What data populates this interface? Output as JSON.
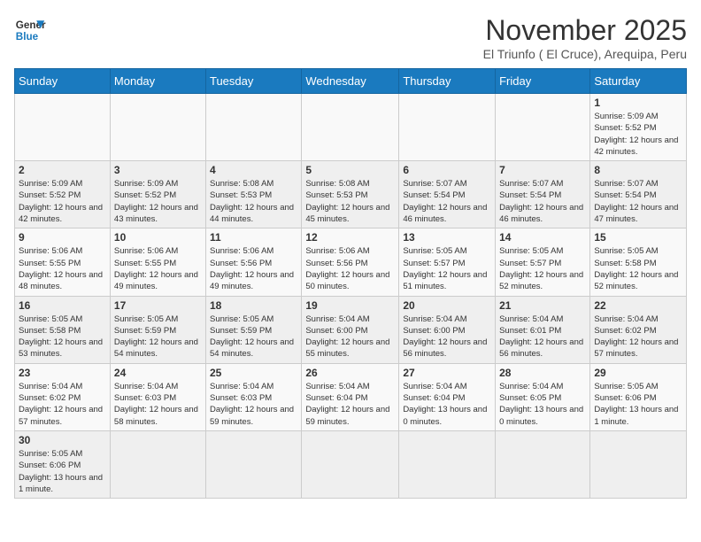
{
  "header": {
    "logo_general": "General",
    "logo_blue": "Blue",
    "title": "November 2025",
    "subtitle": "El Triunfo ( El Cruce), Arequipa, Peru"
  },
  "weekdays": [
    "Sunday",
    "Monday",
    "Tuesday",
    "Wednesday",
    "Thursday",
    "Friday",
    "Saturday"
  ],
  "weeks": [
    [
      {
        "day": "",
        "info": ""
      },
      {
        "day": "",
        "info": ""
      },
      {
        "day": "",
        "info": ""
      },
      {
        "day": "",
        "info": ""
      },
      {
        "day": "",
        "info": ""
      },
      {
        "day": "",
        "info": ""
      },
      {
        "day": "1",
        "info": "Sunrise: 5:09 AM\nSunset: 5:52 PM\nDaylight: 12 hours and 42 minutes."
      }
    ],
    [
      {
        "day": "2",
        "info": "Sunrise: 5:09 AM\nSunset: 5:52 PM\nDaylight: 12 hours and 42 minutes."
      },
      {
        "day": "3",
        "info": "Sunrise: 5:09 AM\nSunset: 5:52 PM\nDaylight: 12 hours and 43 minutes."
      },
      {
        "day": "4",
        "info": "Sunrise: 5:08 AM\nSunset: 5:53 PM\nDaylight: 12 hours and 44 minutes."
      },
      {
        "day": "5",
        "info": "Sunrise: 5:08 AM\nSunset: 5:53 PM\nDaylight: 12 hours and 45 minutes."
      },
      {
        "day": "6",
        "info": "Sunrise: 5:07 AM\nSunset: 5:54 PM\nDaylight: 12 hours and 46 minutes."
      },
      {
        "day": "7",
        "info": "Sunrise: 5:07 AM\nSunset: 5:54 PM\nDaylight: 12 hours and 46 minutes."
      },
      {
        "day": "8",
        "info": "Sunrise: 5:07 AM\nSunset: 5:54 PM\nDaylight: 12 hours and 47 minutes."
      }
    ],
    [
      {
        "day": "9",
        "info": "Sunrise: 5:06 AM\nSunset: 5:55 PM\nDaylight: 12 hours and 48 minutes."
      },
      {
        "day": "10",
        "info": "Sunrise: 5:06 AM\nSunset: 5:55 PM\nDaylight: 12 hours and 49 minutes."
      },
      {
        "day": "11",
        "info": "Sunrise: 5:06 AM\nSunset: 5:56 PM\nDaylight: 12 hours and 49 minutes."
      },
      {
        "day": "12",
        "info": "Sunrise: 5:06 AM\nSunset: 5:56 PM\nDaylight: 12 hours and 50 minutes."
      },
      {
        "day": "13",
        "info": "Sunrise: 5:05 AM\nSunset: 5:57 PM\nDaylight: 12 hours and 51 minutes."
      },
      {
        "day": "14",
        "info": "Sunrise: 5:05 AM\nSunset: 5:57 PM\nDaylight: 12 hours and 52 minutes."
      },
      {
        "day": "15",
        "info": "Sunrise: 5:05 AM\nSunset: 5:58 PM\nDaylight: 12 hours and 52 minutes."
      }
    ],
    [
      {
        "day": "16",
        "info": "Sunrise: 5:05 AM\nSunset: 5:58 PM\nDaylight: 12 hours and 53 minutes."
      },
      {
        "day": "17",
        "info": "Sunrise: 5:05 AM\nSunset: 5:59 PM\nDaylight: 12 hours and 54 minutes."
      },
      {
        "day": "18",
        "info": "Sunrise: 5:05 AM\nSunset: 5:59 PM\nDaylight: 12 hours and 54 minutes."
      },
      {
        "day": "19",
        "info": "Sunrise: 5:04 AM\nSunset: 6:00 PM\nDaylight: 12 hours and 55 minutes."
      },
      {
        "day": "20",
        "info": "Sunrise: 5:04 AM\nSunset: 6:00 PM\nDaylight: 12 hours and 56 minutes."
      },
      {
        "day": "21",
        "info": "Sunrise: 5:04 AM\nSunset: 6:01 PM\nDaylight: 12 hours and 56 minutes."
      },
      {
        "day": "22",
        "info": "Sunrise: 5:04 AM\nSunset: 6:02 PM\nDaylight: 12 hours and 57 minutes."
      }
    ],
    [
      {
        "day": "23",
        "info": "Sunrise: 5:04 AM\nSunset: 6:02 PM\nDaylight: 12 hours and 57 minutes."
      },
      {
        "day": "24",
        "info": "Sunrise: 5:04 AM\nSunset: 6:03 PM\nDaylight: 12 hours and 58 minutes."
      },
      {
        "day": "25",
        "info": "Sunrise: 5:04 AM\nSunset: 6:03 PM\nDaylight: 12 hours and 59 minutes."
      },
      {
        "day": "26",
        "info": "Sunrise: 5:04 AM\nSunset: 6:04 PM\nDaylight: 12 hours and 59 minutes."
      },
      {
        "day": "27",
        "info": "Sunrise: 5:04 AM\nSunset: 6:04 PM\nDaylight: 13 hours and 0 minutes."
      },
      {
        "day": "28",
        "info": "Sunrise: 5:04 AM\nSunset: 6:05 PM\nDaylight: 13 hours and 0 minutes."
      },
      {
        "day": "29",
        "info": "Sunrise: 5:05 AM\nSunset: 6:06 PM\nDaylight: 13 hours and 1 minute."
      }
    ],
    [
      {
        "day": "30",
        "info": "Sunrise: 5:05 AM\nSunset: 6:06 PM\nDaylight: 13 hours and 1 minute."
      },
      {
        "day": "",
        "info": ""
      },
      {
        "day": "",
        "info": ""
      },
      {
        "day": "",
        "info": ""
      },
      {
        "day": "",
        "info": ""
      },
      {
        "day": "",
        "info": ""
      },
      {
        "day": "",
        "info": ""
      }
    ]
  ]
}
